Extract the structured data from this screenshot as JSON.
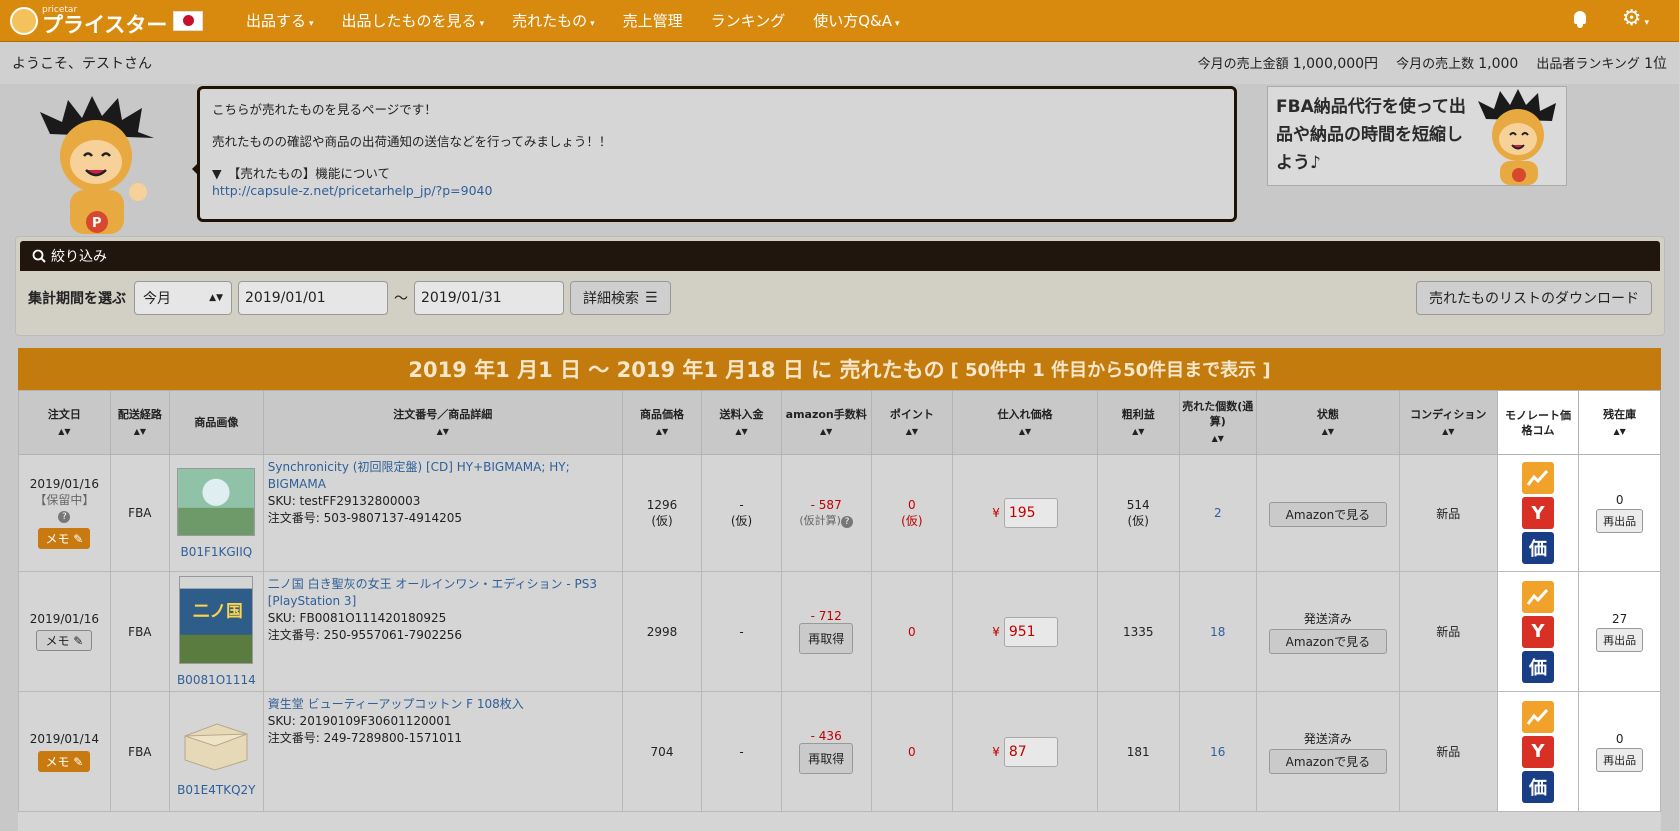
{
  "nav": {
    "logo_small": "pricetar",
    "logo_main": "プライスター",
    "menu": [
      {
        "label": "出品する",
        "dropdown": true
      },
      {
        "label": "出品したものを見る",
        "dropdown": true
      },
      {
        "label": "売れたもの",
        "dropdown": true
      },
      {
        "label": "売上管理",
        "dropdown": false
      },
      {
        "label": "ランキング",
        "dropdown": false
      },
      {
        "label": "使い方Q&A",
        "dropdown": true
      }
    ],
    "icons": [
      "bell-icon",
      "gear-icon"
    ]
  },
  "welcome": {
    "greeting": "ようこそ、テストさん",
    "sales_amount_label": "今月の売上金額",
    "sales_amount": "1,000,000円",
    "sales_count_label": "今月の売上数",
    "sales_count": "1,000",
    "ranking_label": "出品者ランキング",
    "ranking": "1位"
  },
  "info": {
    "line1": "こちらが売れたものを見るページです！",
    "line2": "売れたものの確認や商品の出荷通知の送信などを行ってみましょう！！",
    "line3": "▼　【売れたもの】機能について",
    "link": "http://capsule-z.net/pricetarhelp_jp/?p=9040"
  },
  "banner": {
    "text": "FBA納品代行を使って出品や納品の時間を短縮しよう♪"
  },
  "filter": {
    "title": "絞り込み",
    "period_label": "集計期間を選ぶ",
    "period_value": "今月",
    "date_from": "2019/01/01",
    "tilde": "〜",
    "date_to": "2019/01/31",
    "detail_search": "詳細検索",
    "download": "売れたものリストのダウンロード"
  },
  "result": {
    "title": "2019 年1 月1 日 〜 2019 年1 月18 日 に 売れたもの",
    "subtitle": "[ 50件中 1 件目から50件目まで表示 ]"
  },
  "columns": [
    "注文日",
    "配送経路",
    "商品画像",
    "注文番号／商品詳細",
    "商品価格",
    "送料入金",
    "amazon手数料",
    "ポイント",
    "仕入れ価格",
    "粗利益",
    "売れた個数(通算)",
    "状態",
    "コンディション",
    "モノレート価格コム",
    "残在庫"
  ],
  "rows": [
    {
      "date": "2019/01/16",
      "hold": "【保留中】",
      "memo": "メモ",
      "route": "FBA",
      "asin": "B01F1KGIIQ",
      "title": "Synchronicity (初回限定盤) [CD] HY+BIGMAMA; HY; BIGMAMA",
      "sku": "SKU: testFF29132800003",
      "order": "注文番号: 503-9807137-4914205",
      "price": "1296",
      "price_note": "(仮)",
      "shipping": "-",
      "shipping_note": "(仮)",
      "fee": "- 587",
      "fee_note": "(仮計算)",
      "points": "0",
      "points_note": "(仮)",
      "cost": "195",
      "profit": "514",
      "profit_note": "(仮)",
      "sold": "2",
      "status": "",
      "amazon_btn": "Amazonで見る",
      "condition": "新品",
      "stock": "0",
      "relist": "再出品"
    },
    {
      "date": "2019/01/16",
      "hold": "",
      "memo": "メモ",
      "route": "FBA",
      "asin": "B0081O1114",
      "title": "二ノ国 白き聖灰の女王 オールインワン・エディション - PS3 [PlayStation 3]",
      "sku": "SKU: FB0081O111420180925",
      "order": "注文番号: 250-9557061-7902256",
      "price": "2998",
      "price_note": "",
      "shipping": "-",
      "shipping_note": "",
      "fee": "- 712",
      "fee_btn": "再取得",
      "points": "0",
      "points_note": "",
      "cost": "951",
      "profit": "1335",
      "profit_note": "",
      "sold": "18",
      "status": "発送済み",
      "amazon_btn": "Amazonで見る",
      "condition": "新品",
      "stock": "27",
      "relist": "再出品"
    },
    {
      "date": "2019/01/14",
      "hold": "",
      "memo": "メモ",
      "route": "FBA",
      "asin": "B01E4TKQ2Y",
      "title": "資生堂 ビューティーアップコットン F 108枚入",
      "sku": "SKU: 20190109F30601120001",
      "order": "注文番号: 249-7289800-1571011",
      "price": "704",
      "price_note": "",
      "shipping": "-",
      "shipping_note": "",
      "fee": "- 436",
      "fee_btn": "再取得",
      "points": "0",
      "points_note": "",
      "cost": "87",
      "profit": "181",
      "profit_note": "",
      "sold": "16",
      "status": "発送済み",
      "amazon_btn": "Amazonで見る",
      "condition": "新品",
      "stock": "0",
      "relist": "再出品"
    }
  ],
  "yen": "¥",
  "price_icons": {
    "yahoo": "Y",
    "kakaku": "価"
  }
}
